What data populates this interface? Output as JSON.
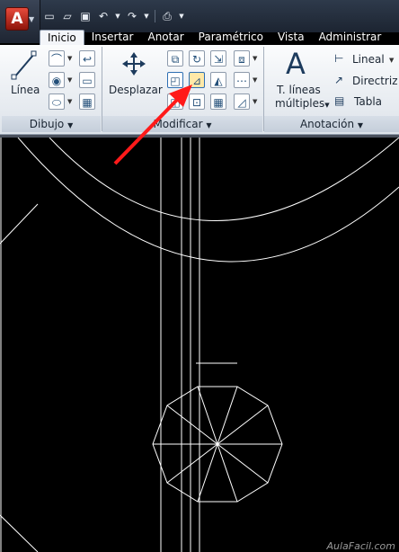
{
  "app": {
    "logo_letter": "A"
  },
  "quick_access": [
    "new-icon",
    "open-icon",
    "save-icon",
    "undo-icon",
    "redo-icon",
    "plot-icon"
  ],
  "tabs": [
    {
      "label": "Inicio",
      "active": true
    },
    {
      "label": "Insertar",
      "active": false
    },
    {
      "label": "Anotar",
      "active": false
    },
    {
      "label": "Paramétrico",
      "active": false
    },
    {
      "label": "Vista",
      "active": false
    },
    {
      "label": "Administrar",
      "active": false
    }
  ],
  "ribbon": {
    "dibujo": {
      "title": "Dibujo",
      "linea_label": "Línea"
    },
    "modificar": {
      "title": "Modificar",
      "desplazar_label": "Desplazar"
    },
    "anotacion": {
      "title": "Anotación",
      "text_label_1": "T. líneas",
      "text_label_2": "múltiples",
      "lineal_label": "Lineal",
      "directriz_label": "Directriz m",
      "tabla_label": "Tabla"
    }
  },
  "watermark": "AulaFacil.com",
  "colors": {
    "highlight_arrow": "#ff1a1a",
    "drawing_lines": "#ffffff",
    "canvas": "#000000"
  }
}
